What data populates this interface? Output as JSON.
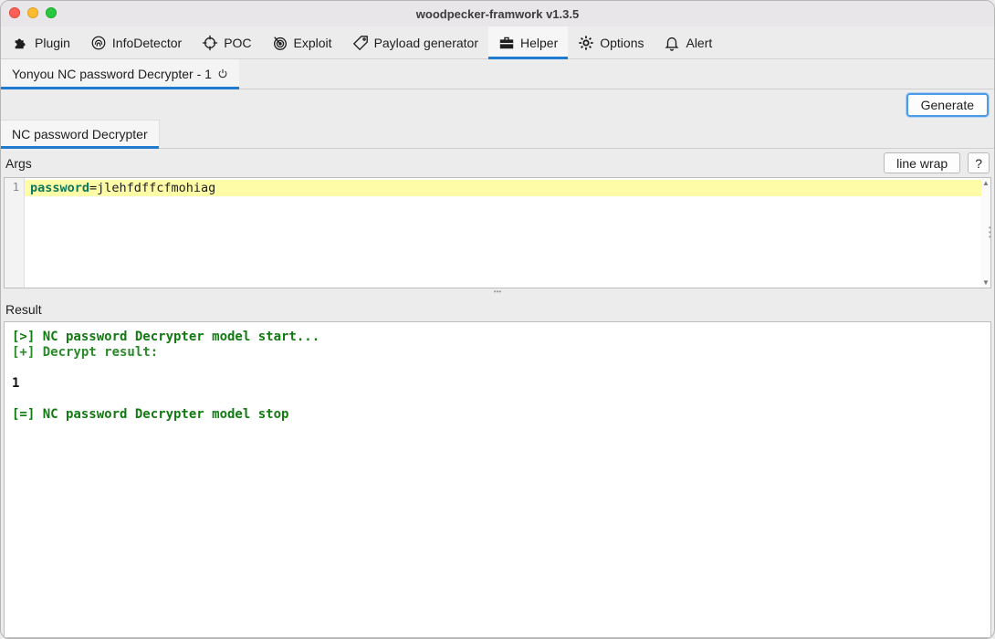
{
  "window": {
    "title": "woodpecker-framwork v1.3.5"
  },
  "toolbar": {
    "tabs": [
      {
        "label": "Plugin",
        "icon": "puzzle-icon"
      },
      {
        "label": "InfoDetector",
        "icon": "fingerprint-icon"
      },
      {
        "label": "POC",
        "icon": "crosshair-icon"
      },
      {
        "label": "Exploit",
        "icon": "target-icon"
      },
      {
        "label": "Payload generator",
        "icon": "tag-icon"
      },
      {
        "label": "Helper",
        "icon": "toolbox-icon",
        "active": true
      },
      {
        "label": "Options",
        "icon": "gear-icon"
      },
      {
        "label": "Alert",
        "icon": "bell-icon"
      }
    ]
  },
  "subtab": {
    "label": "Yonyou NC password Decrypter - 1",
    "icon": "power-icon"
  },
  "generate_label": "Generate",
  "inner_tab": {
    "label": "NC password Decrypter"
  },
  "args": {
    "label": "Args",
    "line_wrap_label": "line wrap",
    "help_label": "?",
    "line_number": "1",
    "key": "password",
    "equals": "=",
    "value": "jlehfdffcfmohiag"
  },
  "result": {
    "label": "Result",
    "lines": [
      "[>] NC password Decrypter model start...",
      "[+] Decrypt result:",
      "1",
      "[=] NC password Decrypter model stop"
    ]
  },
  "colors": {
    "accent": "#1f7bd0",
    "success_text": "#117a11",
    "highlight_line": "#fffca8"
  }
}
